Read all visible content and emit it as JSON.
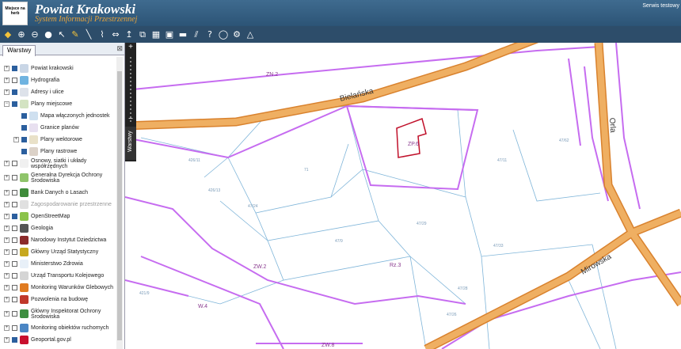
{
  "header": {
    "title": "Powiat Krakowski",
    "subtitle": "System Informacji Przestrzennej",
    "logo_text": "Miejsce na herb",
    "service_text": "Serwis testowy"
  },
  "panel": {
    "tab_label": "Warstwy",
    "close_glyph": "⊠",
    "layers": [
      {
        "label": "Powiat krakowski",
        "toggle": "+",
        "checked": true,
        "icon": "#c9d6e6"
      },
      {
        "label": "Hydrografia",
        "toggle": "+",
        "checked": false,
        "icon": "#6fb3e0"
      },
      {
        "label": "Adresy i ulice",
        "toggle": "+",
        "checked": true,
        "icon": "#dde2ea"
      },
      {
        "label": "Plany miejscowe",
        "toggle": "−",
        "checked": true,
        "icon": "#d3e3c2"
      },
      {
        "label": "Mapa włączonych jednostek",
        "toggle": "",
        "checked": true,
        "icon": "#cfe0f0"
      },
      {
        "label": "Granice planów",
        "toggle": "",
        "checked": true,
        "icon": "#e8e0f0"
      },
      {
        "label": "Plany wektorowe",
        "toggle": "+",
        "checked": true,
        "icon": "#e9e1c8"
      },
      {
        "label": "Plany rastrowe",
        "toggle": "",
        "checked": true,
        "icon": "#dcd2c8"
      },
      {
        "label": "Osnowy, siatki i układy współrzędnych",
        "toggle": "+",
        "checked": false,
        "icon": "#f0f0f0"
      },
      {
        "label": "Generalna Dyrekcja Ochrony Środowiska",
        "toggle": "+",
        "checked": false,
        "icon": "#8fc46a"
      },
      {
        "label": "Bank Danych o Lasach",
        "toggle": "+",
        "checked": false,
        "icon": "#3f8c3a"
      },
      {
        "label": "Zagospodarowanie przestrzenne",
        "toggle": "+",
        "checked": false,
        "icon": "#e0e0e0"
      },
      {
        "label": "OpenStreetMap",
        "toggle": "+",
        "checked": true,
        "icon": "#8bc34a"
      },
      {
        "label": "Geologia",
        "toggle": "+",
        "checked": false,
        "icon": "#555555"
      },
      {
        "label": "Narodowy Instytut Dziedzictwa",
        "toggle": "+",
        "checked": false,
        "icon": "#8b2a2a"
      },
      {
        "label": "Główny Urząd Statystyczny",
        "toggle": "+",
        "checked": false,
        "icon": "#c7a81f"
      },
      {
        "label": "Ministerstwo Zdrowia",
        "toggle": "+",
        "checked": false,
        "icon": "#e8f0f8"
      },
      {
        "label": "Urząd Transportu Kolejowego",
        "toggle": "+",
        "checked": false,
        "icon": "#d5d5d5"
      },
      {
        "label": "Monitoring Warunków Glebowych",
        "toggle": "+",
        "checked": false,
        "icon": "#e07b20"
      },
      {
        "label": "Pozwolenia na budowę",
        "toggle": "+",
        "checked": false,
        "icon": "#c0392b"
      },
      {
        "label": "Główny Inspektorat Ochrony Środowiska",
        "toggle": "+",
        "checked": false,
        "icon": "#3e8e41"
      },
      {
        "label": "Monitoring obiektów ruchomych",
        "toggle": "+",
        "checked": false,
        "icon": "#4b86c4"
      },
      {
        "label": "Geoportal.gov.pl",
        "toggle": "+",
        "checked": true,
        "icon": "#c8102e"
      }
    ]
  },
  "map": {
    "side_tab_label": "Warstwy",
    "zoom_in": "+",
    "zoom_out": "−",
    "street_labels": [
      "Bielańska",
      "Orla",
      "Mirowska"
    ],
    "zones": [
      "ZN.2",
      "ZP.6",
      "Rz.3",
      "ZW.2",
      "W.4",
      "ZW.8"
    ],
    "parcel_labels": [
      "426/11",
      "426/13",
      "47/24",
      "47/9",
      "47/11",
      "47/33",
      "47/29",
      "47/28",
      "47/26",
      "47/62",
      "421/9",
      "71"
    ],
    "colors": {
      "road": "#e8a04e",
      "zone_line": "#c66cf0",
      "parcel_line": "#7fb5d9",
      "highlight": "#c0102a"
    }
  },
  "toolbar": {
    "tools": [
      "layers-icon",
      "zoom-in-icon",
      "zoom-out-icon",
      "full-extent-icon",
      "pointer-icon",
      "pencil-icon",
      "measure-line-icon",
      "measure-area-icon",
      "pan-icon",
      "info-icon",
      "copy-icon",
      "print-icon",
      "grid-icon",
      "car-icon",
      "hatch-icon",
      "help-icon",
      "chat-icon",
      "settings-icon",
      "warning-icon"
    ]
  }
}
